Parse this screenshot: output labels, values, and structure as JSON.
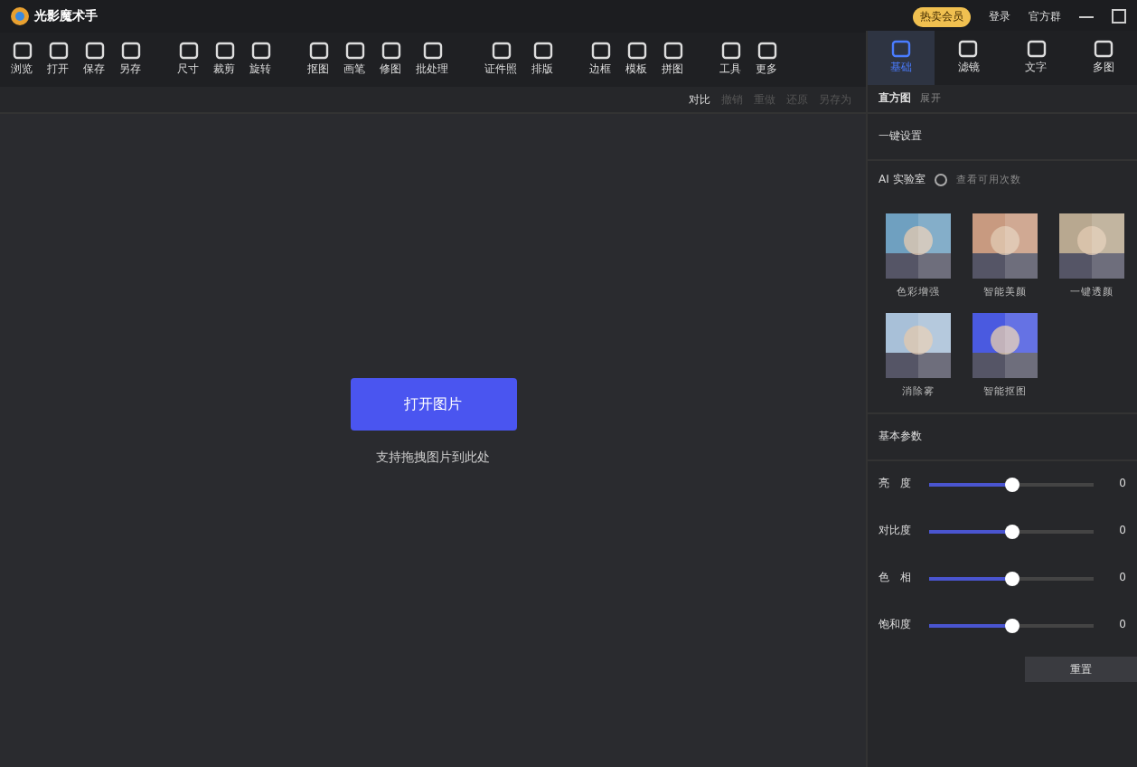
{
  "window": {
    "title": "光影魔术手"
  },
  "title_bar": {
    "vip_badge": "热卖会员",
    "login": "登录",
    "group": "官方群"
  },
  "toolbar": {
    "groups": [
      [
        "浏览",
        "打开",
        "保存",
        "另存"
      ],
      [
        "尺寸",
        "裁剪",
        "旋转"
      ],
      [
        "抠图",
        "画笔",
        "修图",
        "批处理"
      ],
      [
        "证件照",
        "排版"
      ],
      [
        "边框",
        "模板",
        "拼图"
      ],
      [
        "工具",
        "更多"
      ]
    ]
  },
  "sub_toolbar": [
    {
      "label": "对比",
      "disabled": false
    },
    {
      "label": "撤销",
      "disabled": true
    },
    {
      "label": "重做",
      "disabled": true
    },
    {
      "label": "还原",
      "disabled": true
    },
    {
      "label": "另存为",
      "disabled": true
    }
  ],
  "canvas": {
    "open_button": "打开图片",
    "hint": "支持拖拽图片到此处"
  },
  "panel": {
    "tabs": [
      {
        "label": "基础",
        "selected": true
      },
      {
        "label": "滤镜",
        "selected": false
      },
      {
        "label": "文字",
        "selected": false
      },
      {
        "label": "多图",
        "selected": false
      }
    ],
    "histogram": {
      "title": "直方图",
      "action": "展开"
    },
    "quick": "一键设置",
    "ai": {
      "title": "AI 实验室",
      "link": "查看可用次数",
      "items": [
        {
          "label": "色彩增强"
        },
        {
          "label": "智能美颜"
        },
        {
          "label": "一键透颜"
        },
        {
          "label": "消除雾"
        },
        {
          "label": "智能抠图"
        }
      ]
    },
    "basic": {
      "title": "基本参数",
      "sliders": [
        {
          "label": "亮　度",
          "level": 0.5,
          "reading": "0"
        },
        {
          "label": "对比度",
          "level": 0.5,
          "reading": "0"
        },
        {
          "label": "色　相",
          "level": 0.5,
          "reading": "0"
        },
        {
          "label": "饱和度",
          "level": 0.5,
          "reading": "0"
        }
      ],
      "reset": "重置"
    }
  }
}
